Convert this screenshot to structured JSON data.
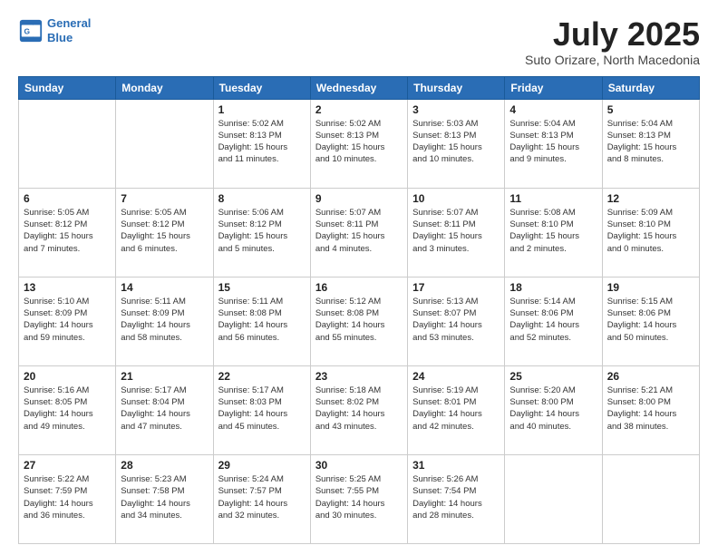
{
  "header": {
    "logo_line1": "General",
    "logo_line2": "Blue",
    "title": "July 2025",
    "subtitle": "Suto Orizare, North Macedonia"
  },
  "days_of_week": [
    "Sunday",
    "Monday",
    "Tuesday",
    "Wednesday",
    "Thursday",
    "Friday",
    "Saturday"
  ],
  "weeks": [
    [
      {
        "day": "",
        "info": ""
      },
      {
        "day": "",
        "info": ""
      },
      {
        "day": "1",
        "info": "Sunrise: 5:02 AM\nSunset: 8:13 PM\nDaylight: 15 hours\nand 11 minutes."
      },
      {
        "day": "2",
        "info": "Sunrise: 5:02 AM\nSunset: 8:13 PM\nDaylight: 15 hours\nand 10 minutes."
      },
      {
        "day": "3",
        "info": "Sunrise: 5:03 AM\nSunset: 8:13 PM\nDaylight: 15 hours\nand 10 minutes."
      },
      {
        "day": "4",
        "info": "Sunrise: 5:04 AM\nSunset: 8:13 PM\nDaylight: 15 hours\nand 9 minutes."
      },
      {
        "day": "5",
        "info": "Sunrise: 5:04 AM\nSunset: 8:13 PM\nDaylight: 15 hours\nand 8 minutes."
      }
    ],
    [
      {
        "day": "6",
        "info": "Sunrise: 5:05 AM\nSunset: 8:12 PM\nDaylight: 15 hours\nand 7 minutes."
      },
      {
        "day": "7",
        "info": "Sunrise: 5:05 AM\nSunset: 8:12 PM\nDaylight: 15 hours\nand 6 minutes."
      },
      {
        "day": "8",
        "info": "Sunrise: 5:06 AM\nSunset: 8:12 PM\nDaylight: 15 hours\nand 5 minutes."
      },
      {
        "day": "9",
        "info": "Sunrise: 5:07 AM\nSunset: 8:11 PM\nDaylight: 15 hours\nand 4 minutes."
      },
      {
        "day": "10",
        "info": "Sunrise: 5:07 AM\nSunset: 8:11 PM\nDaylight: 15 hours\nand 3 minutes."
      },
      {
        "day": "11",
        "info": "Sunrise: 5:08 AM\nSunset: 8:10 PM\nDaylight: 15 hours\nand 2 minutes."
      },
      {
        "day": "12",
        "info": "Sunrise: 5:09 AM\nSunset: 8:10 PM\nDaylight: 15 hours\nand 0 minutes."
      }
    ],
    [
      {
        "day": "13",
        "info": "Sunrise: 5:10 AM\nSunset: 8:09 PM\nDaylight: 14 hours\nand 59 minutes."
      },
      {
        "day": "14",
        "info": "Sunrise: 5:11 AM\nSunset: 8:09 PM\nDaylight: 14 hours\nand 58 minutes."
      },
      {
        "day": "15",
        "info": "Sunrise: 5:11 AM\nSunset: 8:08 PM\nDaylight: 14 hours\nand 56 minutes."
      },
      {
        "day": "16",
        "info": "Sunrise: 5:12 AM\nSunset: 8:08 PM\nDaylight: 14 hours\nand 55 minutes."
      },
      {
        "day": "17",
        "info": "Sunrise: 5:13 AM\nSunset: 8:07 PM\nDaylight: 14 hours\nand 53 minutes."
      },
      {
        "day": "18",
        "info": "Sunrise: 5:14 AM\nSunset: 8:06 PM\nDaylight: 14 hours\nand 52 minutes."
      },
      {
        "day": "19",
        "info": "Sunrise: 5:15 AM\nSunset: 8:06 PM\nDaylight: 14 hours\nand 50 minutes."
      }
    ],
    [
      {
        "day": "20",
        "info": "Sunrise: 5:16 AM\nSunset: 8:05 PM\nDaylight: 14 hours\nand 49 minutes."
      },
      {
        "day": "21",
        "info": "Sunrise: 5:17 AM\nSunset: 8:04 PM\nDaylight: 14 hours\nand 47 minutes."
      },
      {
        "day": "22",
        "info": "Sunrise: 5:17 AM\nSunset: 8:03 PM\nDaylight: 14 hours\nand 45 minutes."
      },
      {
        "day": "23",
        "info": "Sunrise: 5:18 AM\nSunset: 8:02 PM\nDaylight: 14 hours\nand 43 minutes."
      },
      {
        "day": "24",
        "info": "Sunrise: 5:19 AM\nSunset: 8:01 PM\nDaylight: 14 hours\nand 42 minutes."
      },
      {
        "day": "25",
        "info": "Sunrise: 5:20 AM\nSunset: 8:00 PM\nDaylight: 14 hours\nand 40 minutes."
      },
      {
        "day": "26",
        "info": "Sunrise: 5:21 AM\nSunset: 8:00 PM\nDaylight: 14 hours\nand 38 minutes."
      }
    ],
    [
      {
        "day": "27",
        "info": "Sunrise: 5:22 AM\nSunset: 7:59 PM\nDaylight: 14 hours\nand 36 minutes."
      },
      {
        "day": "28",
        "info": "Sunrise: 5:23 AM\nSunset: 7:58 PM\nDaylight: 14 hours\nand 34 minutes."
      },
      {
        "day": "29",
        "info": "Sunrise: 5:24 AM\nSunset: 7:57 PM\nDaylight: 14 hours\nand 32 minutes."
      },
      {
        "day": "30",
        "info": "Sunrise: 5:25 AM\nSunset: 7:55 PM\nDaylight: 14 hours\nand 30 minutes."
      },
      {
        "day": "31",
        "info": "Sunrise: 5:26 AM\nSunset: 7:54 PM\nDaylight: 14 hours\nand 28 minutes."
      },
      {
        "day": "",
        "info": ""
      },
      {
        "day": "",
        "info": ""
      }
    ]
  ]
}
